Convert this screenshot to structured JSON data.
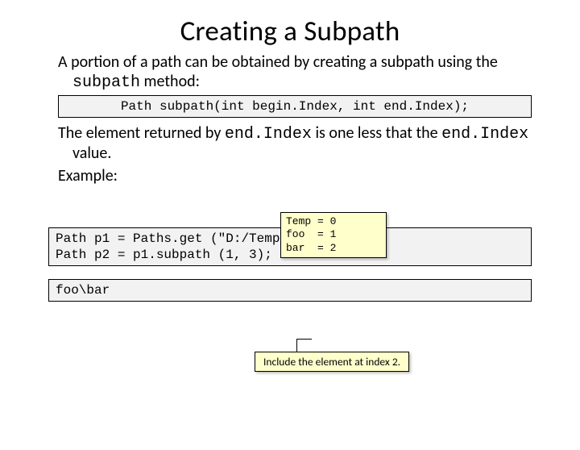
{
  "title": "Creating a Subpath",
  "para1_lead": "A portion of a path can be obtained by creating a subpath using the ",
  "para1_code": "subpath",
  "para1_tail": " method:",
  "sig": "Path subpath(int begin.Index, int end.Index);",
  "para2_lead": "The element returned by ",
  "para2_code1": "end.Index",
  "para2_mid": " is one less that the ",
  "para2_code2": "end.Index",
  "para2_tail": " value.",
  "example_label": "Example:",
  "index_rows": {
    "r0": "Temp = 0",
    "r1": "foo  = 1",
    "r2": "bar  = 2"
  },
  "code_block": "Path p1 = Paths.get (\"D:/Temp/foo/bar\");\nPath p2 = p1.subpath (1, 3);",
  "result": "foo\\bar",
  "include_note": "Include the element at index 2."
}
